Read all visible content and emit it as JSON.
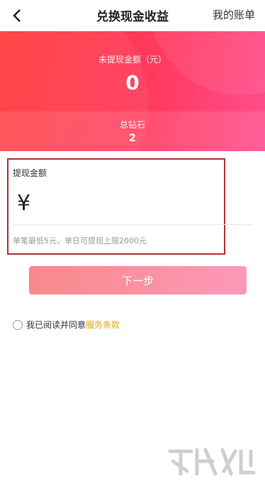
{
  "nav": {
    "title": "兑换现金收益",
    "bill_label": "我的账单"
  },
  "balance": {
    "unwithdrawn_label": "未提现金额（元）",
    "unwithdrawn_value": "0",
    "diamonds_label": "总钻石",
    "diamonds_value": "2"
  },
  "withdraw": {
    "amount_label": "提现金额",
    "currency_symbol": "¥",
    "amount_value": "",
    "hint": "单笔最低5元，单日可提现上限2000元"
  },
  "actions": {
    "next_label": "下一步"
  },
  "agreement": {
    "text": "我已阅读并同意",
    "terms_label": "服务条款"
  },
  "colors": {
    "hero_start": "#ff3b3b",
    "hero_end": "#ff4e8f",
    "highlight_border": "#b23232",
    "terms": "#e0a800"
  },
  "icons": {
    "back": "chevron-left-icon",
    "watermark": "watermark-logo"
  }
}
